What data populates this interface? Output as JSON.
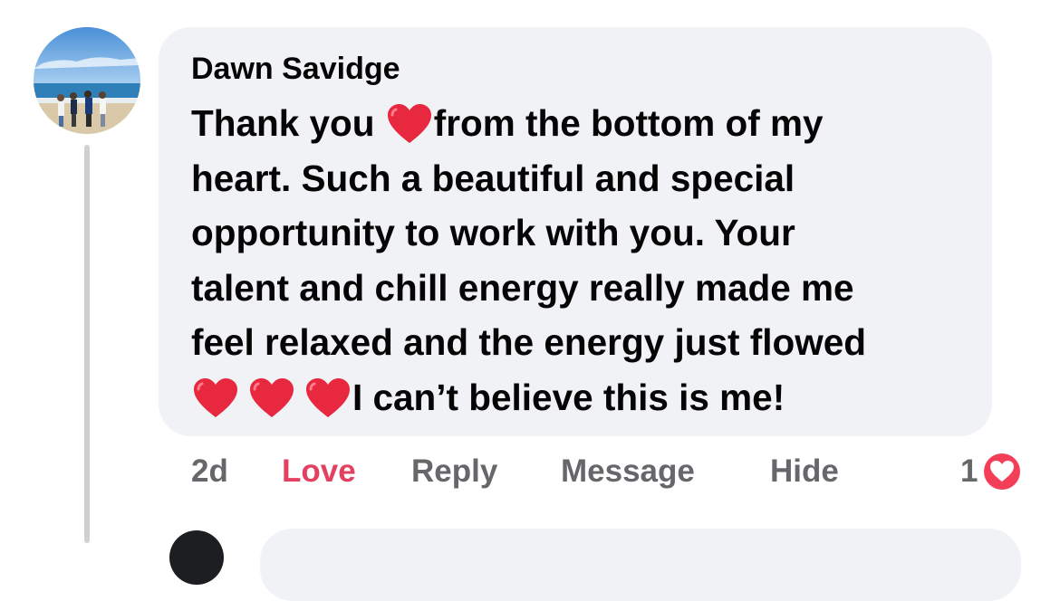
{
  "comment": {
    "author": "Dawn Savidge",
    "text_lines": [
      [
        "Thank you ",
        "heart",
        "from the bottom of my"
      ],
      [
        "heart.  Such a beautiful and special"
      ],
      [
        "opportunity to work with you.  Your"
      ],
      [
        "talent and chill energy really made me"
      ],
      [
        "feel relaxed and the energy just flowed"
      ],
      [
        "heart",
        "heart",
        "heart",
        "I can’t believe this is me!"
      ]
    ],
    "line_1_a": "Thank you ",
    "line_1_b": "from the bottom of my",
    "line_2": "heart.  Such a beautiful and special",
    "line_3": "opportunity to work with you.  Your",
    "line_4": "talent and chill energy really made me",
    "line_5": "feel relaxed and the energy just flowed",
    "line_6": "I can’t believe this is me!"
  },
  "actions": {
    "time": "2d",
    "love_label": "Love",
    "reply_label": "Reply",
    "message_label": "Message",
    "hide_label": "Hide"
  },
  "reactions": {
    "count": "1",
    "icon": "love-reaction-icon"
  },
  "colors": {
    "bubble": "#f0f2f5",
    "love": "#e4405f",
    "secondary_text": "#65676b",
    "heart_emoji": "#e8283f"
  }
}
